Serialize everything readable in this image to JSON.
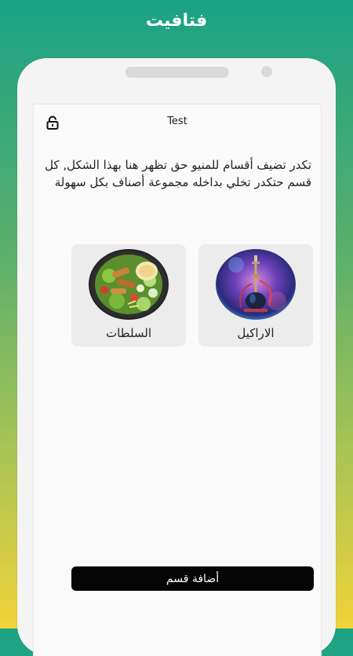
{
  "header": {
    "app_title": "فتافيت"
  },
  "screen": {
    "title": "Test",
    "lock_icon": "lock-icon",
    "intro_text": "تكدر تضيف أقسام للمنيو حق تظهر هنا بهذا الشكل, كل قسم حتكدر تخلي بداخله مجموعة أصناف بكل سهولة"
  },
  "categories": [
    {
      "label": "الاراكيل",
      "image": "hookah-image"
    },
    {
      "label": "السلطات",
      "image": "salad-image"
    }
  ],
  "add_button": {
    "label": "أضافة قسم"
  },
  "colors": {
    "gradient_top": "#1aa285",
    "gradient_bottom": "#f2d23a",
    "button": "#050505",
    "card": "#ececec"
  }
}
